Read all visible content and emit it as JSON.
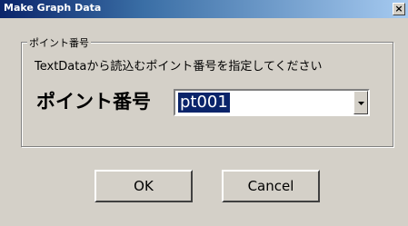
{
  "window": {
    "title": "Make Graph Data",
    "close_label": "×"
  },
  "group": {
    "legend": "ポイント番号",
    "instruction": "TextDataから読込むポイント番号を指定してください",
    "field_label": "ポイント番号",
    "combo": {
      "selected_value": "pt001"
    }
  },
  "buttons": {
    "ok_label": "OK",
    "cancel_label": "Cancel"
  },
  "icons": {
    "combo_arrow": "chevron-down-icon",
    "close": "close-icon"
  },
  "colors": {
    "titlebar_start": "#0a246a",
    "titlebar_end": "#a6caf0",
    "face": "#d4d0c8",
    "selection": "#0a246a"
  }
}
